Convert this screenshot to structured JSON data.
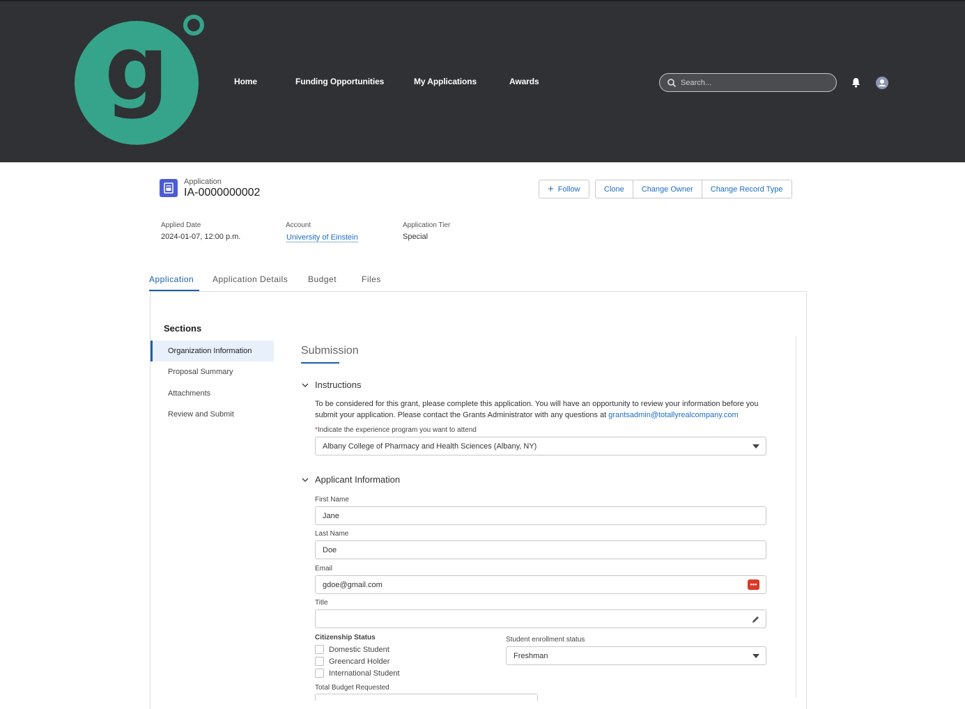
{
  "nav": {
    "home": "Home",
    "funding": "Funding Opportunities",
    "my_apps": "My Applications",
    "awards": "Awards",
    "search_placeholder": "Search..."
  },
  "logo": {
    "letter": "g",
    "color": "#36a48a"
  },
  "record": {
    "type": "Application",
    "name": "IA-0000000002",
    "buttons": {
      "follow": "Follow",
      "clone": "Clone",
      "change_owner": "Change Owner",
      "change_record_type": "Change Record Type"
    }
  },
  "fields": {
    "applied_date_label": "Applied Date",
    "applied_date": "2024-01-07, 12:00 p.m.",
    "account_label": "Account",
    "account": "University of Einstein",
    "tier_label": "Application Tier",
    "tier": "Special"
  },
  "tabs": [
    "Application",
    "Application Details",
    "Budget",
    "Files"
  ],
  "sections": {
    "title": "Sections",
    "items": [
      "Organization Information",
      "Proposal Summary",
      "Attachments",
      "Review and Submit"
    ]
  },
  "form": {
    "heading": "Submission",
    "instructions_title": "Instructions",
    "instructions_text": "To be considered for this grant, please complete this application. You will have an opportunity to review your information before you submit your application. Please contact the Grants Administrator with any questions at ",
    "instructions_email": "grantsadmin@totallyrealcompany.com",
    "program_label": "Indicate the experience program you want to attend",
    "program_value": "Albany College of Pharmacy and Health Sciences (Albany, NY)",
    "applicant_title": "Applicant Information",
    "first_name_label": "First Name",
    "first_name": "Jane",
    "last_name_label": "Last Name",
    "last_name": "Doe",
    "email_label": "Email",
    "email": "gdoe@gmail.com",
    "title_label": "Title",
    "title_value": "",
    "citizenship_label": "Citizenship Status",
    "citizenship_options": [
      "Domestic Student",
      "Greencard Holder",
      "International Student"
    ],
    "enrollment_label": "Student enrollment status",
    "enrollment_value": "Freshman",
    "budget_label": "Total Budget Requested"
  },
  "colors": {
    "header_bg": "#2f3134",
    "accent": "#1b5fa8",
    "link": "#1b6ec2"
  }
}
